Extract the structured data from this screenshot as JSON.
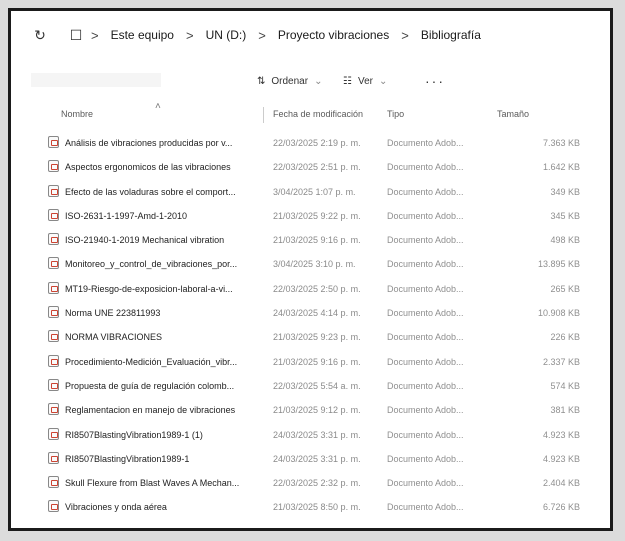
{
  "address_bar": {
    "crumbs": [
      "Este equipo",
      "UN (D:)",
      "Proyecto vibraciones",
      "Bibliografía"
    ],
    "separator": ">"
  },
  "toolbar": {
    "sort_label": "Ordenar",
    "view_label": "Ver",
    "more_label": "···"
  },
  "columns": {
    "name": "Nombre",
    "date": "Fecha de modificación",
    "type": "Tipo",
    "size": "Tamaño"
  },
  "files": [
    {
      "name": "Análisis de vibraciones producidas por v...",
      "date": "22/03/2025 2:19 p. m.",
      "type": "Documento Adob...",
      "size": "7.363 KB"
    },
    {
      "name": "Aspectos ergonomicos de las vibraciones",
      "date": "22/03/2025 2:51 p. m.",
      "type": "Documento Adob...",
      "size": "1.642 KB"
    },
    {
      "name": "Efecto de las voladuras sobre el comport...",
      "date": "3/04/2025 1:07 p. m.",
      "type": "Documento Adob...",
      "size": "349 KB"
    },
    {
      "name": "ISO-2631-1-1997-Amd-1-2010",
      "date": "21/03/2025 9:22 p. m.",
      "type": "Documento Adob...",
      "size": "345 KB"
    },
    {
      "name": "ISO-21940-1-2019 Mechanical vibration",
      "date": "21/03/2025 9:16 p. m.",
      "type": "Documento Adob...",
      "size": "498 KB"
    },
    {
      "name": "Monitoreo_y_control_de_vibraciones_por...",
      "date": "3/04/2025 3:10 p. m.",
      "type": "Documento Adob...",
      "size": "13.895 KB"
    },
    {
      "name": "MT19-Riesgo-de-exposicion-laboral-a-vi...",
      "date": "22/03/2025 2:50 p. m.",
      "type": "Documento Adob...",
      "size": "265 KB"
    },
    {
      "name": "Norma UNE 223811993",
      "date": "24/03/2025 4:14 p. m.",
      "type": "Documento Adob...",
      "size": "10.908 KB"
    },
    {
      "name": "NORMA VIBRACIONES",
      "date": "21/03/2025 9:23 p. m.",
      "type": "Documento Adob...",
      "size": "226 KB"
    },
    {
      "name": "Procedimiento-Medición_Evaluación_vibr...",
      "date": "21/03/2025 9:16 p. m.",
      "type": "Documento Adob...",
      "size": "2.337 KB"
    },
    {
      "name": "Propuesta de guía de regulación colomb...",
      "date": "22/03/2025 5:54 a. m.",
      "type": "Documento Adob...",
      "size": "574 KB"
    },
    {
      "name": "Reglamentacion en manejo de vibraciones",
      "date": "21/03/2025 9:12 p. m.",
      "type": "Documento Adob...",
      "size": "381 KB"
    },
    {
      "name": "RI8507BlastingVibration1989-1 (1)",
      "date": "24/03/2025 3:31 p. m.",
      "type": "Documento Adob...",
      "size": "4.923 KB"
    },
    {
      "name": "RI8507BlastingVibration1989-1",
      "date": "24/03/2025 3:31 p. m.",
      "type": "Documento Adob...",
      "size": "4.923 KB"
    },
    {
      "name": "Skull Flexure from Blast Waves A Mechan...",
      "date": "22/03/2025 2:32 p. m.",
      "type": "Documento Adob...",
      "size": "2.404 KB"
    },
    {
      "name": "Vibraciones y onda aérea",
      "date": "21/03/2025 8:50 p. m.",
      "type": "Documento Adob...",
      "size": "6.726 KB"
    }
  ],
  "icons": {
    "refresh": "refresh-icon",
    "monitor": "monitor-icon",
    "sort": "sort-icon",
    "view": "view-icon",
    "file": "pdf-file-icon"
  }
}
